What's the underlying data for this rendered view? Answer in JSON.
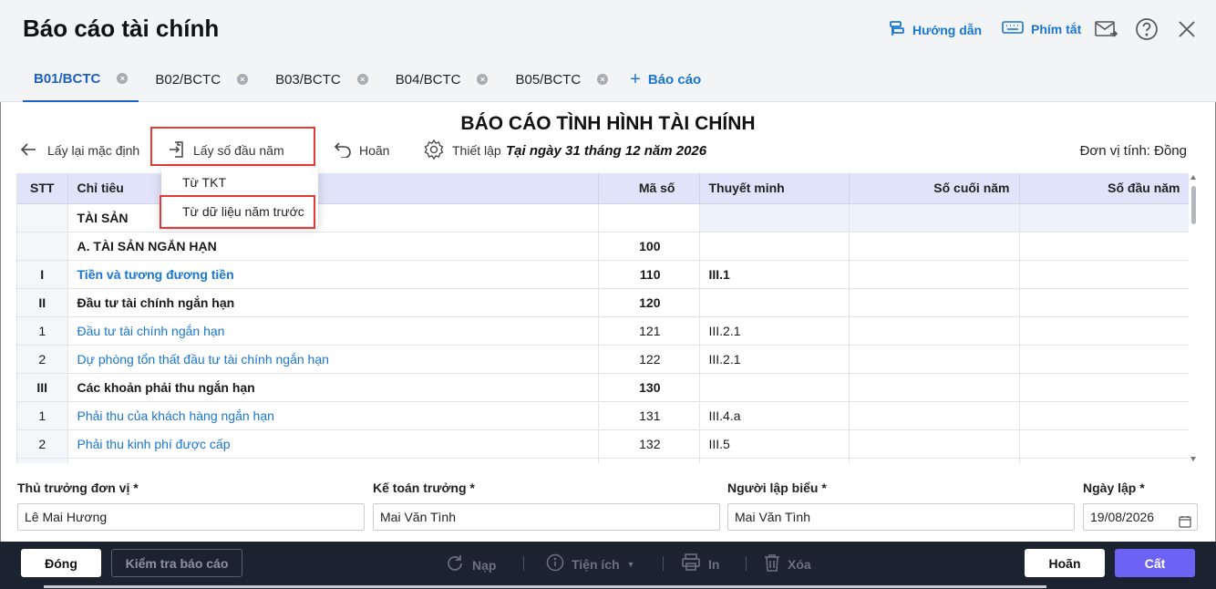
{
  "app_title": "Báo cáo tài chính",
  "header_links": {
    "guide": "Hướng dẫn",
    "shortcuts": "Phím tắt"
  },
  "tabs": [
    {
      "label": "B01/BCTC",
      "active": true
    },
    {
      "label": "B02/BCTC",
      "active": false
    },
    {
      "label": "B03/BCTC",
      "active": false
    },
    {
      "label": "B04/BCTC",
      "active": false
    },
    {
      "label": "B05/BCTC",
      "active": false
    }
  ],
  "add_report_label": "Báo cáo",
  "report_title": "BÁO CÁO TÌNH HÌNH TÀI CHÍNH",
  "toolbar": {
    "reset_default": "Lấy lại mặc định",
    "get_opening": "Lấy số đầu năm",
    "undo": "Hoãn",
    "settings": "Thiết lập",
    "date_line": "Tại ngày 31 tháng 12 năm 2026",
    "unit": "Đơn vị tính: Đồng"
  },
  "dropdown": {
    "items": [
      "Từ TKT",
      "Từ dữ liệu năm trước"
    ]
  },
  "table": {
    "columns": [
      "STT",
      "Chỉ tiêu",
      "Mã số",
      "Thuyết minh",
      "Số cuối năm",
      "Số đầu năm"
    ],
    "rows": [
      {
        "stt": "",
        "name": "TÀI SẢN",
        "code": "",
        "note": "",
        "bold": true,
        "link": false
      },
      {
        "stt": "",
        "name": "A. TÀI SẢN NGẮN HẠN",
        "code": "100",
        "note": "",
        "bold": true,
        "link": false
      },
      {
        "stt": "I",
        "name": "Tiền và tương đương tiền",
        "code": "110",
        "note": "III.1",
        "bold": true,
        "link": true
      },
      {
        "stt": "II",
        "name": "Đầu tư tài chính ngắn hạn",
        "code": "120",
        "note": "",
        "bold": true,
        "link": false
      },
      {
        "stt": "1",
        "name": "Đầu tư tài chính ngắn hạn",
        "code": "121",
        "note": "III.2.1",
        "bold": false,
        "link": true
      },
      {
        "stt": "2",
        "name": "Dự phòng tổn thất đầu tư tài chính ngắn hạn",
        "code": "122",
        "note": "III.2.1",
        "bold": false,
        "link": true
      },
      {
        "stt": "III",
        "name": "Các khoản phải thu ngắn hạn",
        "code": "130",
        "note": "",
        "bold": true,
        "link": false
      },
      {
        "stt": "1",
        "name": "Phải thu của khách hàng ngắn hạn",
        "code": "131",
        "note": "III.4.a",
        "bold": false,
        "link": true
      },
      {
        "stt": "2",
        "name": "Phải thu kinh phí được cấp",
        "code": "132",
        "note": "III.5",
        "bold": false,
        "link": true
      }
    ]
  },
  "signers": {
    "head": {
      "label": "Thủ trưởng đơn vị *",
      "value": "Lê Mai Hương"
    },
    "chief_accountant": {
      "label": "Kế toán trưởng *",
      "value": "Mai Văn Tình"
    },
    "preparer": {
      "label": "Người lập biểu *",
      "value": "Mai Văn Tình"
    },
    "date": {
      "label": "Ngày lập *",
      "value": "19/08/2026"
    }
  },
  "footer": {
    "close": "Đóng",
    "check": "Kiểm tra báo cáo",
    "load": "Nạp",
    "utilities": "Tiện ích",
    "print": "In",
    "delete": "Xóa",
    "cancel": "Hoãn",
    "save": "Cất"
  }
}
